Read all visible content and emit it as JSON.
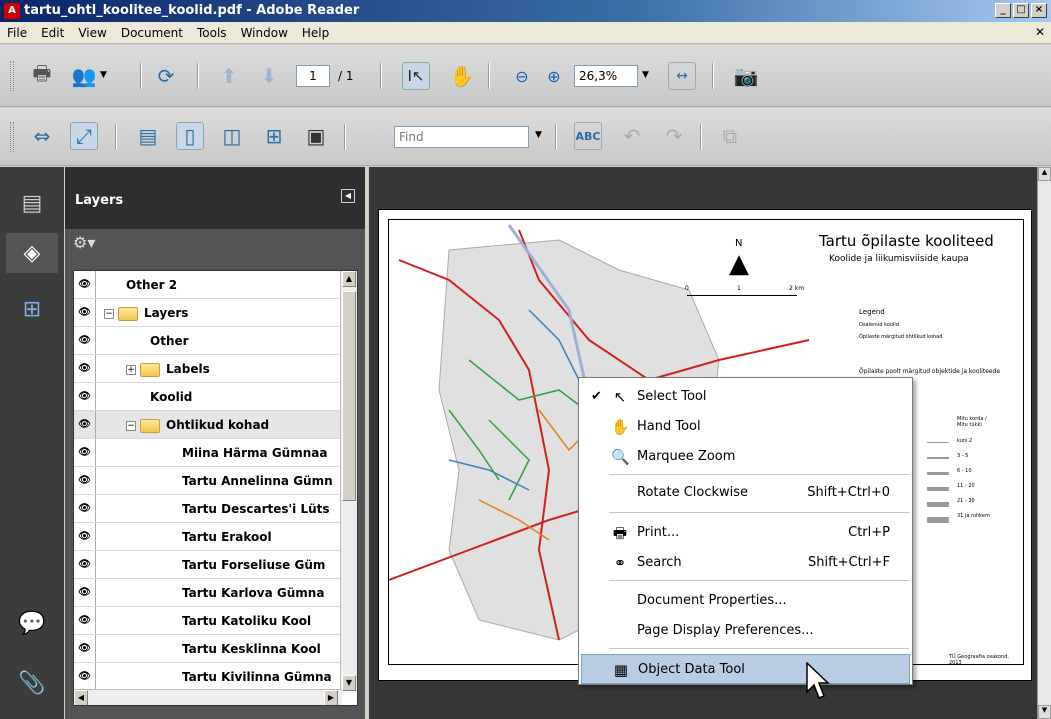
{
  "window": {
    "title": "tartu_ohtl_koolitee_koolid.pdf - Adobe Reader"
  },
  "menu": [
    "File",
    "Edit",
    "View",
    "Document",
    "Tools",
    "Window",
    "Help"
  ],
  "toolbar": {
    "page_current": "1",
    "page_total": "/ 1",
    "zoom": "26,3%",
    "find_placeholder": "Find"
  },
  "layers_panel": {
    "title": "Layers",
    "rows": [
      {
        "label": "Other 2",
        "indent": 0,
        "expander": "",
        "folder": false
      },
      {
        "label": "Layers",
        "indent": 0,
        "expander": "−",
        "folder": true
      },
      {
        "label": "Other",
        "indent": 1,
        "expander": "",
        "folder": false
      },
      {
        "label": "Labels",
        "indent": 1,
        "expander": "+",
        "folder": true
      },
      {
        "label": "Koolid",
        "indent": 1,
        "expander": "",
        "folder": false
      },
      {
        "label": "Ohtlikud kohad",
        "indent": 1,
        "expander": "−",
        "folder": true
      },
      {
        "label": "Miina Härma Gümnaa",
        "indent": 2,
        "expander": "",
        "folder": false
      },
      {
        "label": "Tartu Annelinna Gümn",
        "indent": 2,
        "expander": "",
        "folder": false
      },
      {
        "label": "Tartu Descartes'i Lüts",
        "indent": 2,
        "expander": "",
        "folder": false
      },
      {
        "label": "Tartu Erakool",
        "indent": 2,
        "expander": "",
        "folder": false
      },
      {
        "label": "Tartu Forseliuse Güm",
        "indent": 2,
        "expander": "",
        "folder": false
      },
      {
        "label": "Tartu Karlova Gümna",
        "indent": 2,
        "expander": "",
        "folder": false
      },
      {
        "label": "Tartu Katoliku Kool",
        "indent": 2,
        "expander": "",
        "folder": false
      },
      {
        "label": "Tartu Kesklinna Kool",
        "indent": 2,
        "expander": "",
        "folder": false
      },
      {
        "label": "Tartu Kivilinna Gümna",
        "indent": 2,
        "expander": "",
        "folder": false
      }
    ]
  },
  "map": {
    "title": "Tartu õpilaste kooliteed",
    "subtitle": "Koolide ja liikumisviiside kaupa",
    "north": "N",
    "scale_labels": [
      "0",
      "1",
      "2 km"
    ],
    "legend_title": "Legend",
    "legend_items": [
      "Osalenud koolid",
      "Õpilaste märgitud ohtlikud kohad"
    ],
    "legend_heading2": "Õpilaste poolt märgitud objektide ja kooliteede",
    "count_heading": "Mitu korda / Mitu tükki",
    "classes": [
      "kuni 2",
      "3 - 5",
      "6 - 10",
      "11 - 20",
      "21 - 30",
      "31 ja rohkem"
    ],
    "credit": "TÜ Geograafia osakond, 2013"
  },
  "context_menu": {
    "items": [
      {
        "label": "Select Tool",
        "shortcut": "",
        "icon": "select-arrow-icon",
        "checked": true
      },
      {
        "label": "Hand Tool",
        "shortcut": "",
        "icon": "hand-icon",
        "checked": false
      },
      {
        "label": "Marquee Zoom",
        "shortcut": "",
        "icon": "marquee-zoom-icon",
        "checked": false
      },
      {
        "label": "Rotate Clockwise",
        "shortcut": "Shift+Ctrl+0",
        "icon": "",
        "checked": false
      },
      {
        "label": "Print...",
        "shortcut": "Ctrl+P",
        "icon": "printer-icon",
        "checked": false
      },
      {
        "label": "Search",
        "shortcut": "Shift+Ctrl+F",
        "icon": "binoculars-icon",
        "checked": false
      },
      {
        "label": "Document Properties...",
        "shortcut": "",
        "icon": "",
        "checked": false
      },
      {
        "label": "Page Display Preferences...",
        "shortcut": "",
        "icon": "",
        "checked": false
      },
      {
        "label": "Object Data Tool",
        "shortcut": "",
        "icon": "object-data-icon",
        "checked": false
      }
    ]
  },
  "colors": {
    "accent": "#b8cce4",
    "titlebar": "#0a246a",
    "panel": "#3c3c3c"
  }
}
